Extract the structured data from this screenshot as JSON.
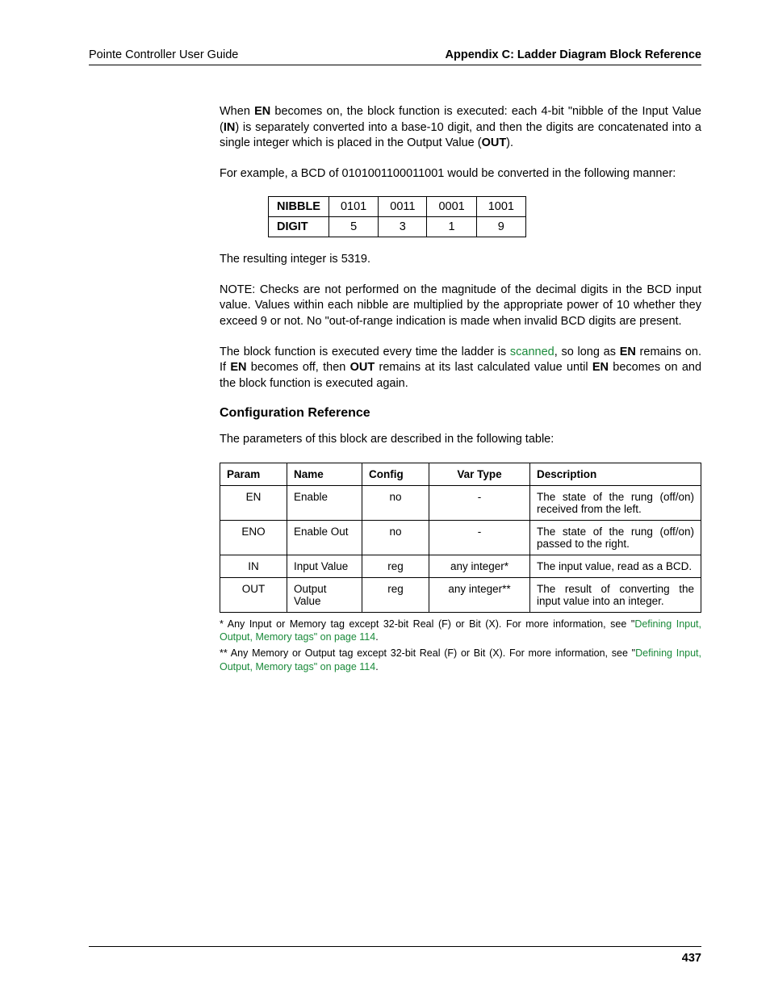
{
  "header": {
    "left": "Pointe Controller User Guide",
    "right": "Appendix C: Ladder Diagram Block Reference"
  },
  "body": {
    "p1_a": "When ",
    "p1_b": "EN",
    "p1_c": " becomes on, the block function is executed: each 4-bit \"nibble of the Input Value (",
    "p1_d": "IN",
    "p1_e": ") is separately converted into a base-10 digit, and then the digits are concatenated into a single integer which is placed in the Output Value (",
    "p1_f": "OUT",
    "p1_g": ").",
    "p2": "For example, a BCD of 0101001100011001 would be converted in the following manner:",
    "nibble_table": {
      "row1_label": "NIBBLE",
      "row1": [
        "0101",
        "0011",
        "0001",
        "1001"
      ],
      "row2_label": "DIGIT",
      "row2": [
        "5",
        "3",
        "1",
        "9"
      ]
    },
    "p3": "The resulting integer is 5319.",
    "p4": "NOTE: Checks are not performed on the magnitude of the decimal digits in the BCD input value. Values within each nibble are multiplied by the appropriate power of 10 whether they exceed 9 or not. No \"out-of-range indication is made when invalid BCD digits are present.",
    "p5_a": "The block function is executed every time the ladder is ",
    "p5_b": "scanned",
    "p5_c": ", so long as ",
    "p5_d": "EN",
    "p5_e": " remains on. If ",
    "p5_f": "EN",
    "p5_g": " becomes off, then ",
    "p5_h": "OUT",
    "p5_i": " remains at its last calculated value until ",
    "p5_j": "EN",
    "p5_k": " becomes on and the block function is executed again.",
    "section_title": "Configuration Reference",
    "p6": "The parameters of this block are described in the following table:",
    "params_table": {
      "headers": [
        "Param",
        "Name",
        "Config",
        "Var Type",
        "Description"
      ],
      "rows": [
        [
          "EN",
          "Enable",
          "no",
          "-",
          "The state of the rung (off/on) received from the left."
        ],
        [
          "ENO",
          "Enable Out",
          "no",
          "-",
          "The state of the rung (off/on) passed to the right."
        ],
        [
          "IN",
          "Input Value",
          "reg",
          "any integer*",
          "The input value, read as a BCD."
        ],
        [
          "OUT",
          "Output Value",
          "reg",
          "any integer**",
          "The result of converting the input value into an integer."
        ]
      ]
    },
    "fn1_a": "* Any Input or Memory tag except 32-bit Real (F) or Bit (X). For more information, see \"",
    "fn1_b": "Defining Input, Output, Memory tags\" on page 114",
    "fn1_c": ".",
    "fn2_a": "** Any Memory or Output tag except 32-bit Real (F) or Bit (X). For more information, see \"",
    "fn2_b": "Defining Input, Output, Memory tags\" on page 114",
    "fn2_c": "."
  },
  "footer": {
    "page": "437"
  }
}
